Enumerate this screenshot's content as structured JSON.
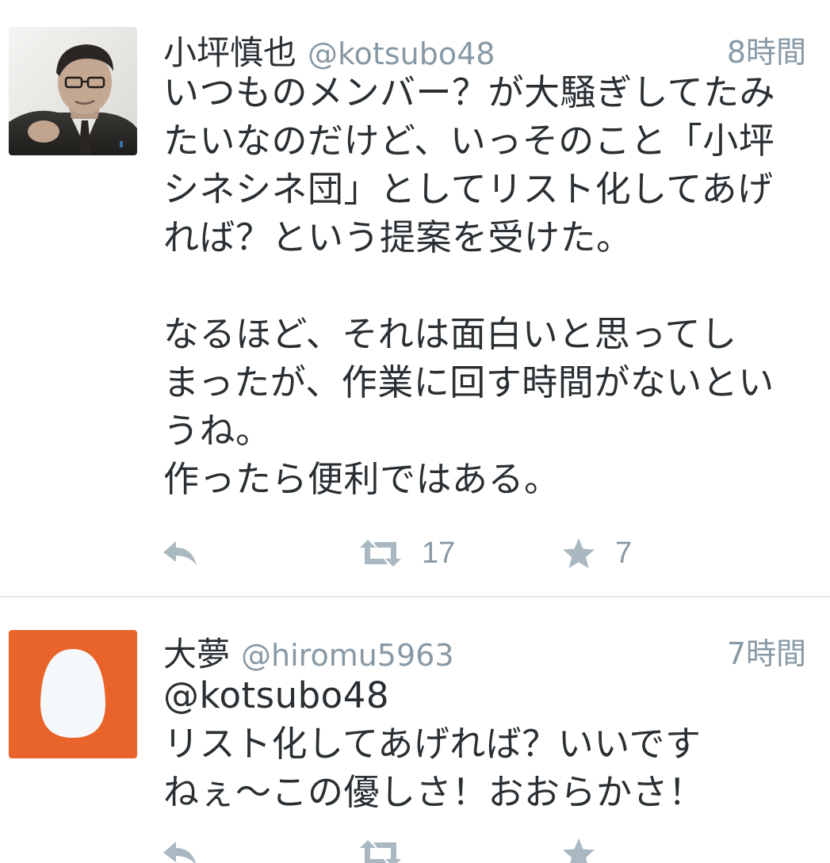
{
  "colors": {
    "text": "#292f33",
    "muted": "#8899a6",
    "action_icon": "#aab8c2",
    "divider": "#e1e8ed",
    "egg_avatar_bg": "#e8642a",
    "egg": "#f5f8fa"
  },
  "tweets": [
    {
      "display_name": "小坪慎也",
      "screen_name": "@kotsubo48",
      "timestamp": "8時間",
      "avatar_icon": "user-photo-avatar",
      "text": "いつものメンバー？が大騒ぎしてたみ\nたいなのだけど、いっそのこと「小坪\nシネシネ団」としてリスト化してあげ\nれば？という提案を受けた。\n\nなるほど、それは面白いと思ってし\nまったが、作業に回す時間がないとい\nうね。\n作ったら便利ではある。",
      "retweet_count": "17",
      "favorite_count": "7"
    },
    {
      "display_name": "大夢",
      "screen_name": "@hiromu5963",
      "timestamp": "7時間",
      "avatar_icon": "egg-avatar",
      "text": "@kotsubo48\nリスト化してあげれば？いいです\nねぇ～この優しさ！おおらかさ！",
      "retweet_count": "",
      "favorite_count": ""
    }
  ]
}
